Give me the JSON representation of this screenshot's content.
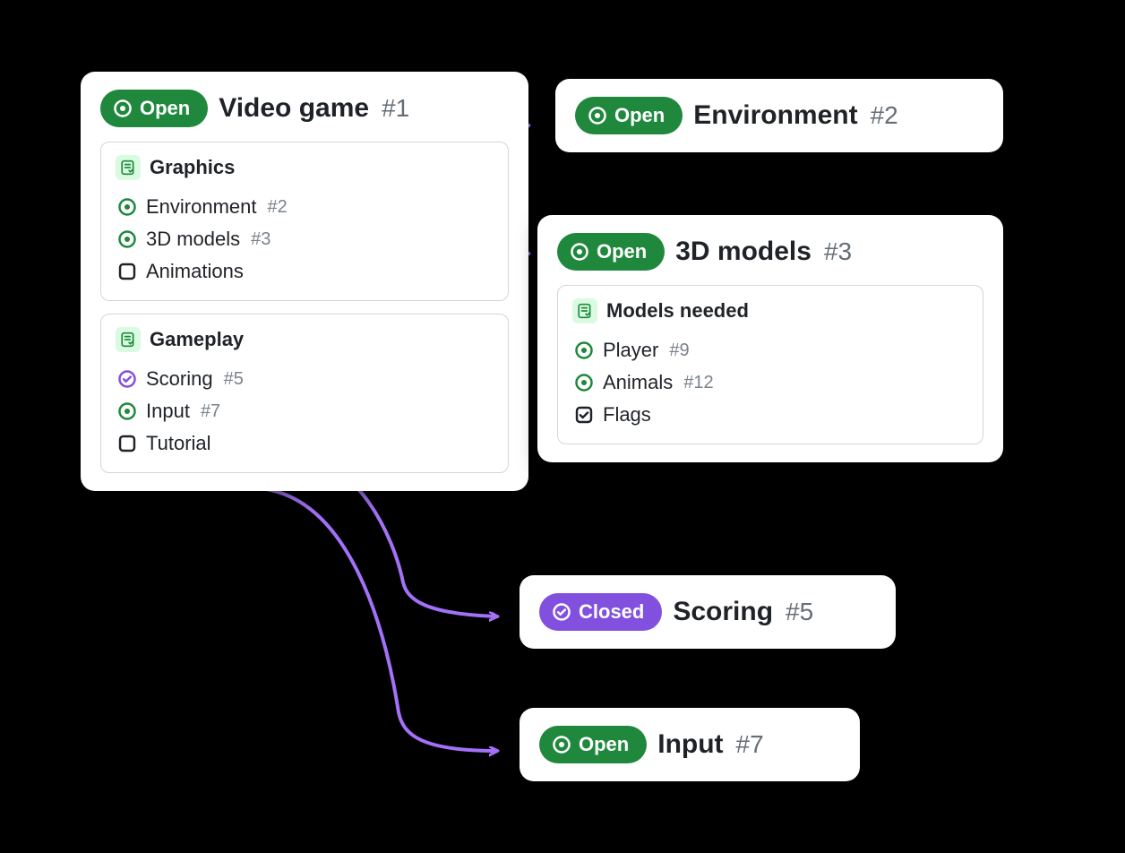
{
  "colors": {
    "open": "#1f883d",
    "closed": "#8250df",
    "arrow": "#a371f7"
  },
  "labels": {
    "open": "Open",
    "closed": "Closed"
  },
  "cards": {
    "main": {
      "status": "open",
      "title": "Video game",
      "number": "#1",
      "tasklists": [
        {
          "title": "Graphics",
          "items": [
            {
              "icon": "open",
              "label": "Environment",
              "number": "#2"
            },
            {
              "icon": "open",
              "label": "3D models",
              "number": "#3"
            },
            {
              "icon": "unchecked",
              "label": "Animations",
              "number": ""
            }
          ]
        },
        {
          "title": "Gameplay",
          "items": [
            {
              "icon": "closed",
              "label": "Scoring",
              "number": "#5"
            },
            {
              "icon": "open",
              "label": "Input",
              "number": "#7"
            },
            {
              "icon": "unchecked",
              "label": "Tutorial",
              "number": ""
            }
          ]
        }
      ]
    },
    "environment": {
      "status": "open",
      "title": "Environment",
      "number": "#2"
    },
    "models": {
      "status": "open",
      "title": "3D models",
      "number": "#3",
      "tasklist": {
        "title": "Models needed",
        "items": [
          {
            "icon": "open",
            "label": "Player",
            "number": "#9"
          },
          {
            "icon": "open",
            "label": "Animals",
            "number": "#12"
          },
          {
            "icon": "checked",
            "label": "Flags",
            "number": ""
          }
        ]
      }
    },
    "scoring": {
      "status": "closed",
      "title": "Scoring",
      "number": "#5"
    },
    "input": {
      "status": "open",
      "title": "Input",
      "number": "#7"
    }
  }
}
